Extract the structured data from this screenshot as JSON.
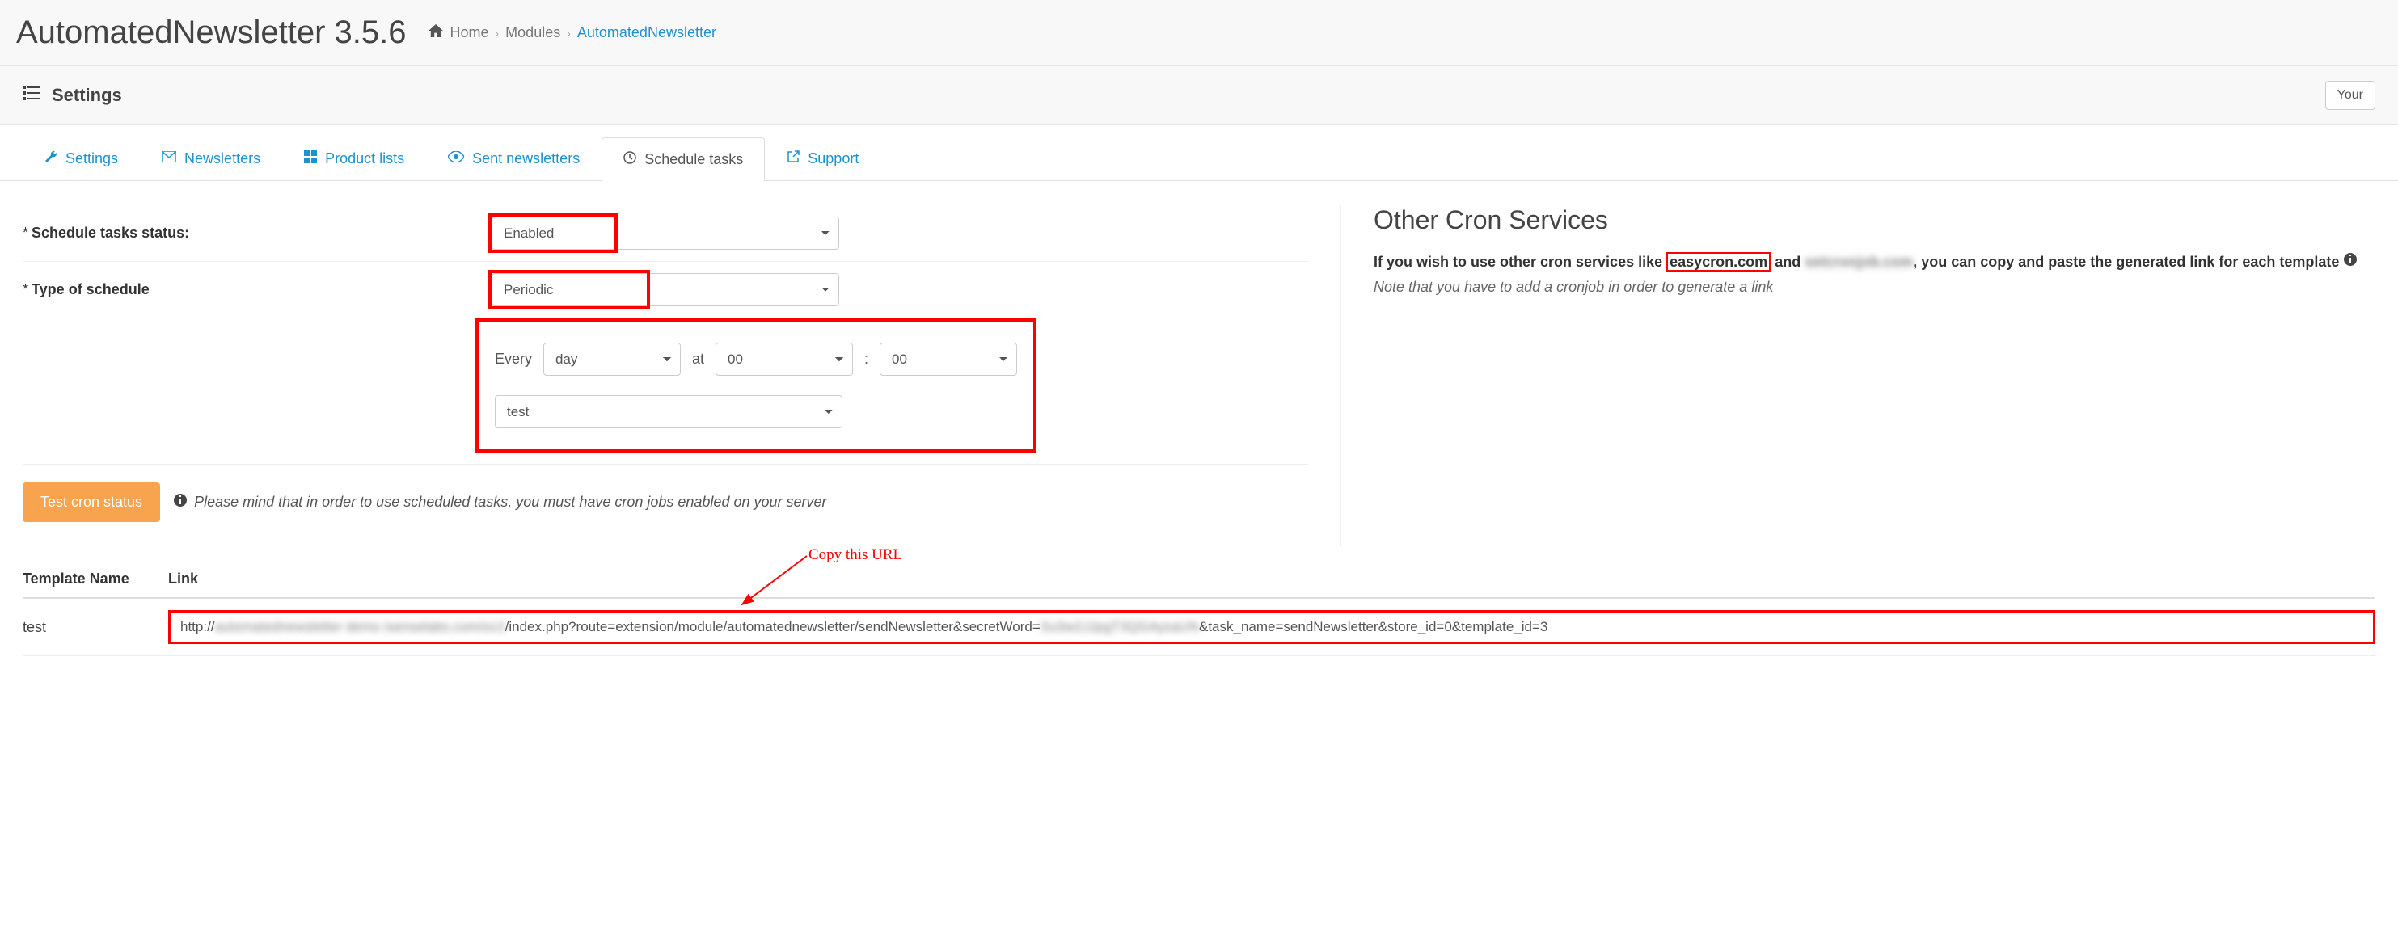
{
  "header": {
    "title": "AutomatedNewsletter 3.5.6",
    "breadcrumb": {
      "home": "Home",
      "modules": "Modules",
      "current": "AutomatedNewsletter"
    }
  },
  "subheader": {
    "title": "Settings",
    "right_label": "Your"
  },
  "tabs": {
    "settings": "Settings",
    "newsletters": "Newsletters",
    "product_lists": "Product lists",
    "sent": "Sent newsletters",
    "schedule": "Schedule tasks",
    "support": "Support"
  },
  "form": {
    "status_label": "Schedule tasks status:",
    "status_value": "Enabled",
    "type_label": "Type of schedule",
    "type_value": "Periodic",
    "every_label": "Every",
    "unit_value": "day",
    "at_label": "at",
    "hour_value": "00",
    "colon": ":",
    "minute_value": "00",
    "template_value": "test"
  },
  "actions": {
    "test_cron": "Test cron status",
    "note": "Please mind that in order to use scheduled tasks, you must have cron jobs enabled on your server"
  },
  "right": {
    "title": "Other Cron Services",
    "text_pre": "If you wish to use other cron services like ",
    "easycron": "easycron.com",
    "text_mid": " and ",
    "blurred": "setcronjob.com",
    "text_post": ", you can copy and paste the generated link for each template ",
    "note": "Note that you have to add a cronjob in order to generate a link"
  },
  "table": {
    "th_name": "Template Name",
    "th_link": "Link",
    "rows": [
      {
        "name": "test",
        "link_prefix": "http://",
        "link_blur1": "automatednewsletter demo isenselabs.com/oc2",
        "link_mid": "/index.php?route=extension/module/automatednewsletter/sendNewsletter&secretWord=",
        "link_blur2": "Su3w2JJpgT3QGAysaUN",
        "link_suffix": "&task_name=sendNewsletter&store_id=0&template_id=3"
      }
    ]
  },
  "annot": {
    "copy": "Copy this URL"
  },
  "icons": {
    "home": "home-icon",
    "list": "list-icon",
    "wrench": "wrench-icon",
    "envelope": "envelope-icon",
    "grid": "grid-icon",
    "eye": "eye-icon",
    "clock": "clock-icon",
    "share": "share-icon",
    "info": "info-icon"
  }
}
